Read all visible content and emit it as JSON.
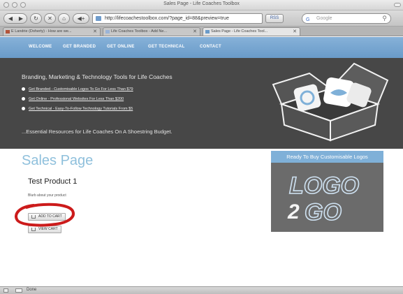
{
  "window": {
    "title": "Sales Page - Life Coaches Toolbox"
  },
  "toolbar": {
    "back_icon": "back-arrow-icon",
    "forward_icon": "forward-arrow-icon",
    "reload_icon": "reload-icon",
    "stop_icon": "stop-icon",
    "home_icon": "home-icon",
    "add_icon": "add-bookmark-icon",
    "url": "http://lifecoachestoolbox.com/?page_id=88&preview=true",
    "rss_label": "RSS",
    "search_placeholder": "Google"
  },
  "tabs": [
    {
      "label": "E Landrie (Doherty) - How are we..."
    },
    {
      "label": "Life Coaches Toolbox - Add Ne..."
    },
    {
      "label": "Sales Page - Life Coaches Tool..."
    }
  ],
  "nav": {
    "items": [
      "WELCOME",
      "GET BRANDED",
      "GET ONLINE",
      "GET TECHNICAL",
      "CONTACT"
    ]
  },
  "hero": {
    "tagline": "Branding, Marketing & Technology Tools for Life Coaches",
    "bullets": [
      "Get Branded - Customisable Logos To Go For Less Than $79",
      "Get Online - Professional Websites For Less Than $200",
      "Get Technical - Easy-To-Follow Technology Tutorials From $5"
    ],
    "footer": "...Essential Resources for Life Coaches On A Shoestring Budget."
  },
  "main": {
    "page_title": "Sales Page",
    "product_title": "Test Product 1",
    "product_blurb": "Blurb about your product",
    "add_to_cart_label": "ADD TO CART",
    "view_cart_label": "VIEW CART"
  },
  "sidebar": {
    "heading": "Ready To Buy Customisable Logos",
    "logo_line1": "LOGO",
    "logo_line2": "GO",
    "logo_number": "2"
  },
  "status": {
    "text": "Done"
  },
  "colors": {
    "nav_blue": "#74a4cf",
    "hero_dark": "#474747",
    "title_blue": "#8fc0dc",
    "annotation_red": "#cc1b1b"
  }
}
